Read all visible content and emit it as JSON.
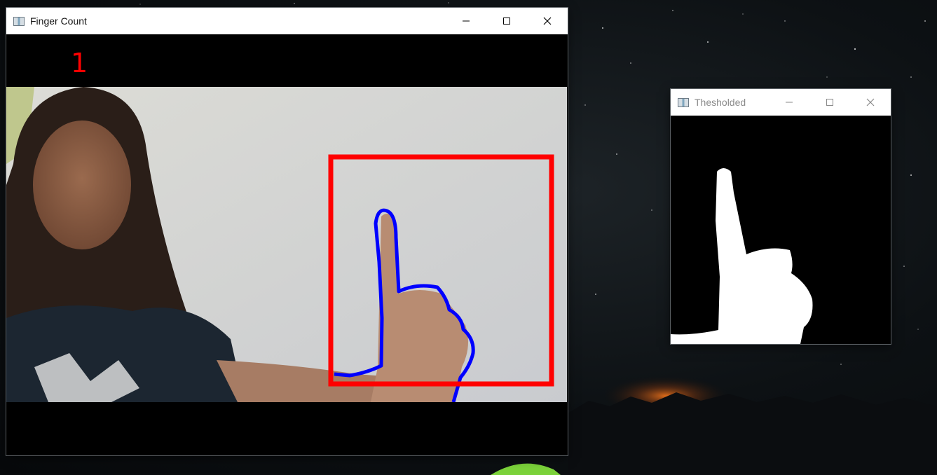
{
  "main_window": {
    "title": "Finger Count",
    "finger_count": "1",
    "controls": {
      "minimize": "minimize",
      "maximize": "maximize",
      "close": "close"
    }
  },
  "threshold_window": {
    "title": "Thesholded",
    "controls": {
      "minimize": "minimize",
      "maximize": "maximize",
      "close": "close"
    }
  },
  "colors": {
    "roi_box": "#ff0000",
    "hand_contour": "#0000ff",
    "count_text": "#ff0000",
    "mask_fg": "#ffffff",
    "mask_bg": "#000000"
  },
  "icons": [
    "app-icon",
    "minimize-icon",
    "maximize-icon",
    "close-icon"
  ]
}
